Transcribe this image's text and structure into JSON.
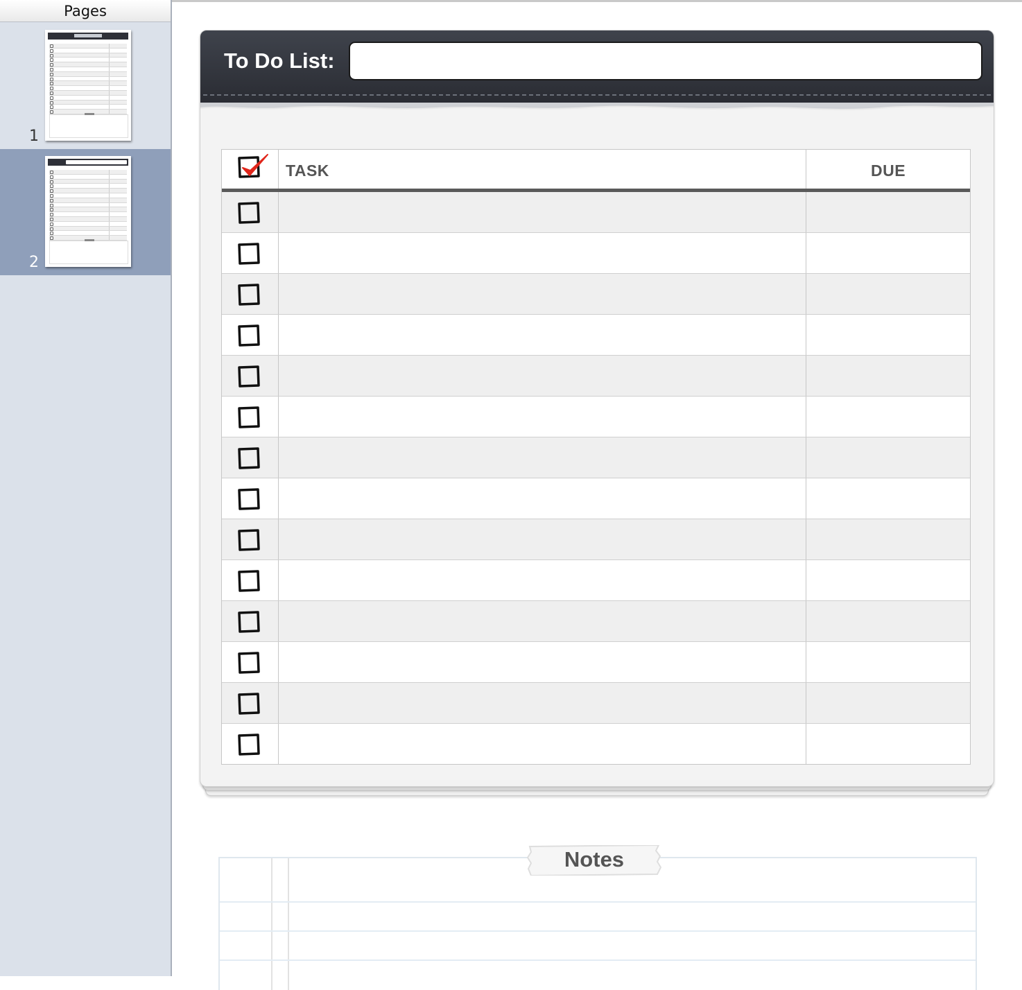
{
  "sidebar": {
    "title": "Pages",
    "pages": [
      {
        "number": "1",
        "selected": false
      },
      {
        "number": "2",
        "selected": true
      }
    ]
  },
  "document": {
    "header": {
      "label": "To Do List:",
      "title_value": ""
    },
    "table": {
      "columns": {
        "task": "TASK",
        "due": "DUE"
      },
      "header_checked": true,
      "rows": [
        {
          "task": "",
          "due": "",
          "checked": false
        },
        {
          "task": "",
          "due": "",
          "checked": false
        },
        {
          "task": "",
          "due": "",
          "checked": false
        },
        {
          "task": "",
          "due": "",
          "checked": false
        },
        {
          "task": "",
          "due": "",
          "checked": false
        },
        {
          "task": "",
          "due": "",
          "checked": false
        },
        {
          "task": "",
          "due": "",
          "checked": false
        },
        {
          "task": "",
          "due": "",
          "checked": false
        },
        {
          "task": "",
          "due": "",
          "checked": false
        },
        {
          "task": "",
          "due": "",
          "checked": false
        },
        {
          "task": "",
          "due": "",
          "checked": false
        },
        {
          "task": "",
          "due": "",
          "checked": false
        },
        {
          "task": "",
          "due": "",
          "checked": false
        },
        {
          "task": "",
          "due": "",
          "checked": false
        }
      ]
    },
    "notes": {
      "label": "Notes"
    }
  },
  "colors": {
    "header_bg": "#2e3038",
    "sidebar_bg": "#dbe1ea",
    "selected_page_bg": "#8f9fba",
    "check_mark": "#e0261b",
    "row_shade": "#efefef"
  },
  "icons": {
    "checkbox": "checkbox-icon",
    "check_mark": "red-check-mark-icon"
  }
}
